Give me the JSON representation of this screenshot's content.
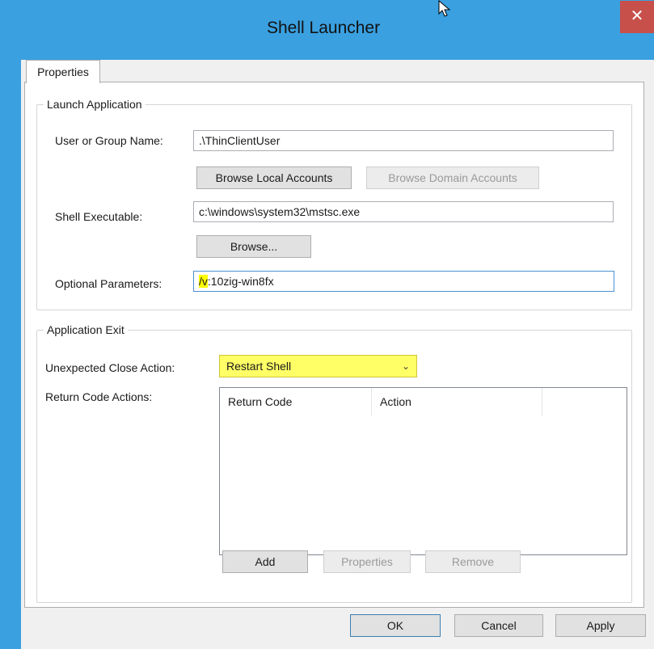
{
  "window": {
    "title": "Shell Launcher",
    "close_glyph": "✕"
  },
  "tabs": [
    {
      "label": "Properties"
    }
  ],
  "launch_application": {
    "group_title": "Launch Application",
    "user_label": "User or Group Name:",
    "user_value": ".\\ThinClientUser",
    "browse_local_label": "Browse Local Accounts",
    "browse_domain_label": "Browse Domain Accounts",
    "shell_label": "Shell Executable:",
    "shell_value": "c:\\windows\\system32\\mstsc.exe",
    "browse_label": "Browse...",
    "params_label": "Optional Parameters:",
    "params_value_highlight": "/v",
    "params_value_rest": ":10zig-win8fx"
  },
  "application_exit": {
    "group_title": "Application Exit",
    "close_action_label": "Unexpected Close Action:",
    "close_action_value": "Restart Shell",
    "return_code_label": "Return Code Actions:",
    "columns": [
      "Return Code",
      "Action"
    ],
    "add_label": "Add",
    "properties_label": "Properties",
    "remove_label": "Remove"
  },
  "footer": {
    "ok_label": "OK",
    "cancel_label": "Cancel",
    "apply_label": "Apply"
  },
  "colors": {
    "titlebar": "#3aa0e0",
    "close": "#c7504a",
    "highlight": "#ffff00"
  }
}
